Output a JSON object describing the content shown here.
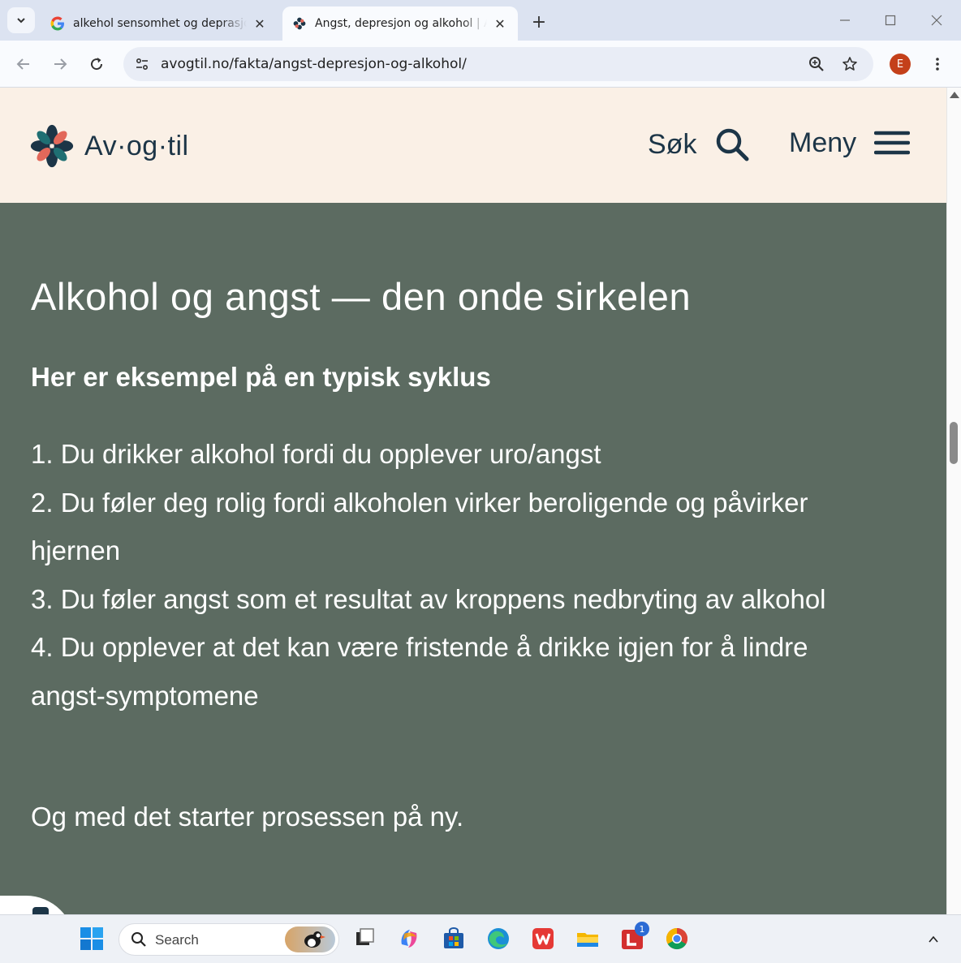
{
  "browser": {
    "tabs": [
      {
        "title": "alkehol sensomhet og deprasjon - Google Search",
        "active": false
      },
      {
        "title": "Angst, depresjon og alkohol | Av-og-til",
        "active": true
      }
    ],
    "new_tab_label": "+",
    "url": "avogtil.no/fakta/angst-depresjon-og-alkohol/",
    "profile_initial": "E"
  },
  "site": {
    "logo_text": "Av·og·til",
    "search_label": "Søk",
    "menu_label": "Meny"
  },
  "article": {
    "heading": "Alkohol og angst — den onde sirkelen",
    "subheading": "Her er eksempel på en typisk syklus",
    "cycle": [
      "1. Du drikker alkohol fordi du opplever uro/angst",
      "2. Du føler deg rolig fordi alkoholen virker beroligende og påvirker hjernen",
      "3. Du føler angst som et resultat av kroppens nedbryting av alkohol",
      "4. Du opplever at det kan være fristende å drikke igjen for å lindre angst-symptomene"
    ],
    "outro": "Og med det starter prosessen på ny."
  },
  "taskbar": {
    "search_placeholder": "Search",
    "mail_badge": "1"
  },
  "colors": {
    "header_bg": "#faf0e6",
    "content_bg": "#5c6b61",
    "brand_dark": "#1c3547",
    "logo_teal": "#1f6f73",
    "logo_coral": "#e2685a"
  }
}
